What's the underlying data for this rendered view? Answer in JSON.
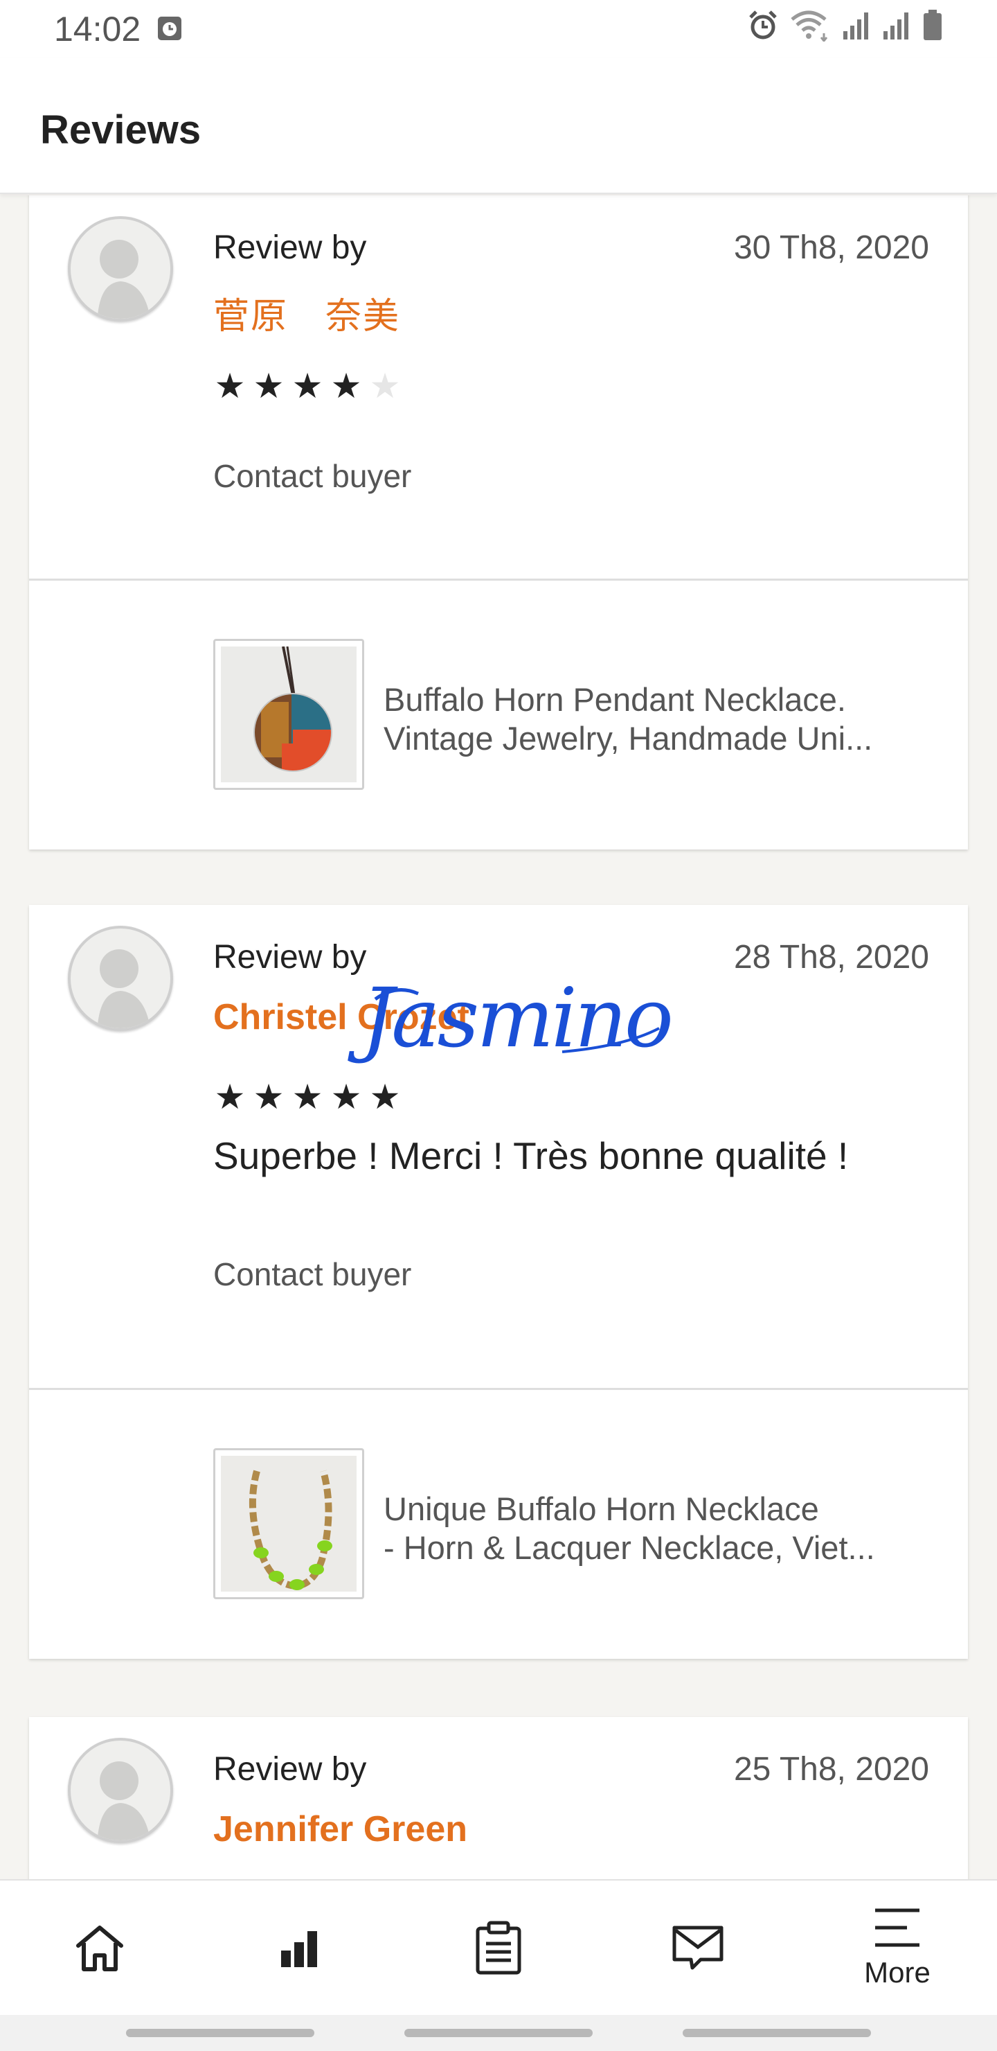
{
  "status_bar": {
    "time": "14:02",
    "icons": [
      "clock-app-icon",
      "alarm-icon",
      "wifi-icon",
      "signal-icon",
      "signal-icon-2",
      "battery-icon"
    ]
  },
  "header": {
    "title": "Reviews"
  },
  "reviews": [
    {
      "review_by_label": "Review by",
      "reviewer": "菅原　奈美",
      "date": "30 Th8, 2020",
      "rating": 4,
      "text": "",
      "contact_label": "Contact buyer",
      "product": {
        "title_line1": "Buffalo Horn Pendant Necklace.",
        "title_line2": "Vintage Jewelry, Handmade Uni..."
      }
    },
    {
      "review_by_label": "Review by",
      "reviewer": "Christel Crozet",
      "date": "28 Th8, 2020",
      "rating": 5,
      "text": "Superbe ! Merci !  Très bonne qualité !",
      "contact_label": "Contact buyer",
      "signature_overlay": "Jasmino",
      "product": {
        "title_line1": "Unique Buffalo Horn Necklace",
        "title_line2": "- Horn & Lacquer Necklace, Viet..."
      }
    },
    {
      "review_by_label": "Review by",
      "reviewer": "Jennifer Green",
      "date": "25 Th8, 2020"
    }
  ],
  "bottom_nav": {
    "items": [
      {
        "icon": "home-icon",
        "label": ""
      },
      {
        "icon": "stats-icon",
        "label": ""
      },
      {
        "icon": "orders-icon",
        "label": ""
      },
      {
        "icon": "messages-icon",
        "label": ""
      },
      {
        "icon": "menu-icon",
        "label": "More"
      }
    ]
  },
  "colors": {
    "accent": "#e3701e",
    "text_primary": "#222222",
    "text_secondary": "#555555",
    "background": "#f5f4f1",
    "signature": "#1a4fd6"
  }
}
